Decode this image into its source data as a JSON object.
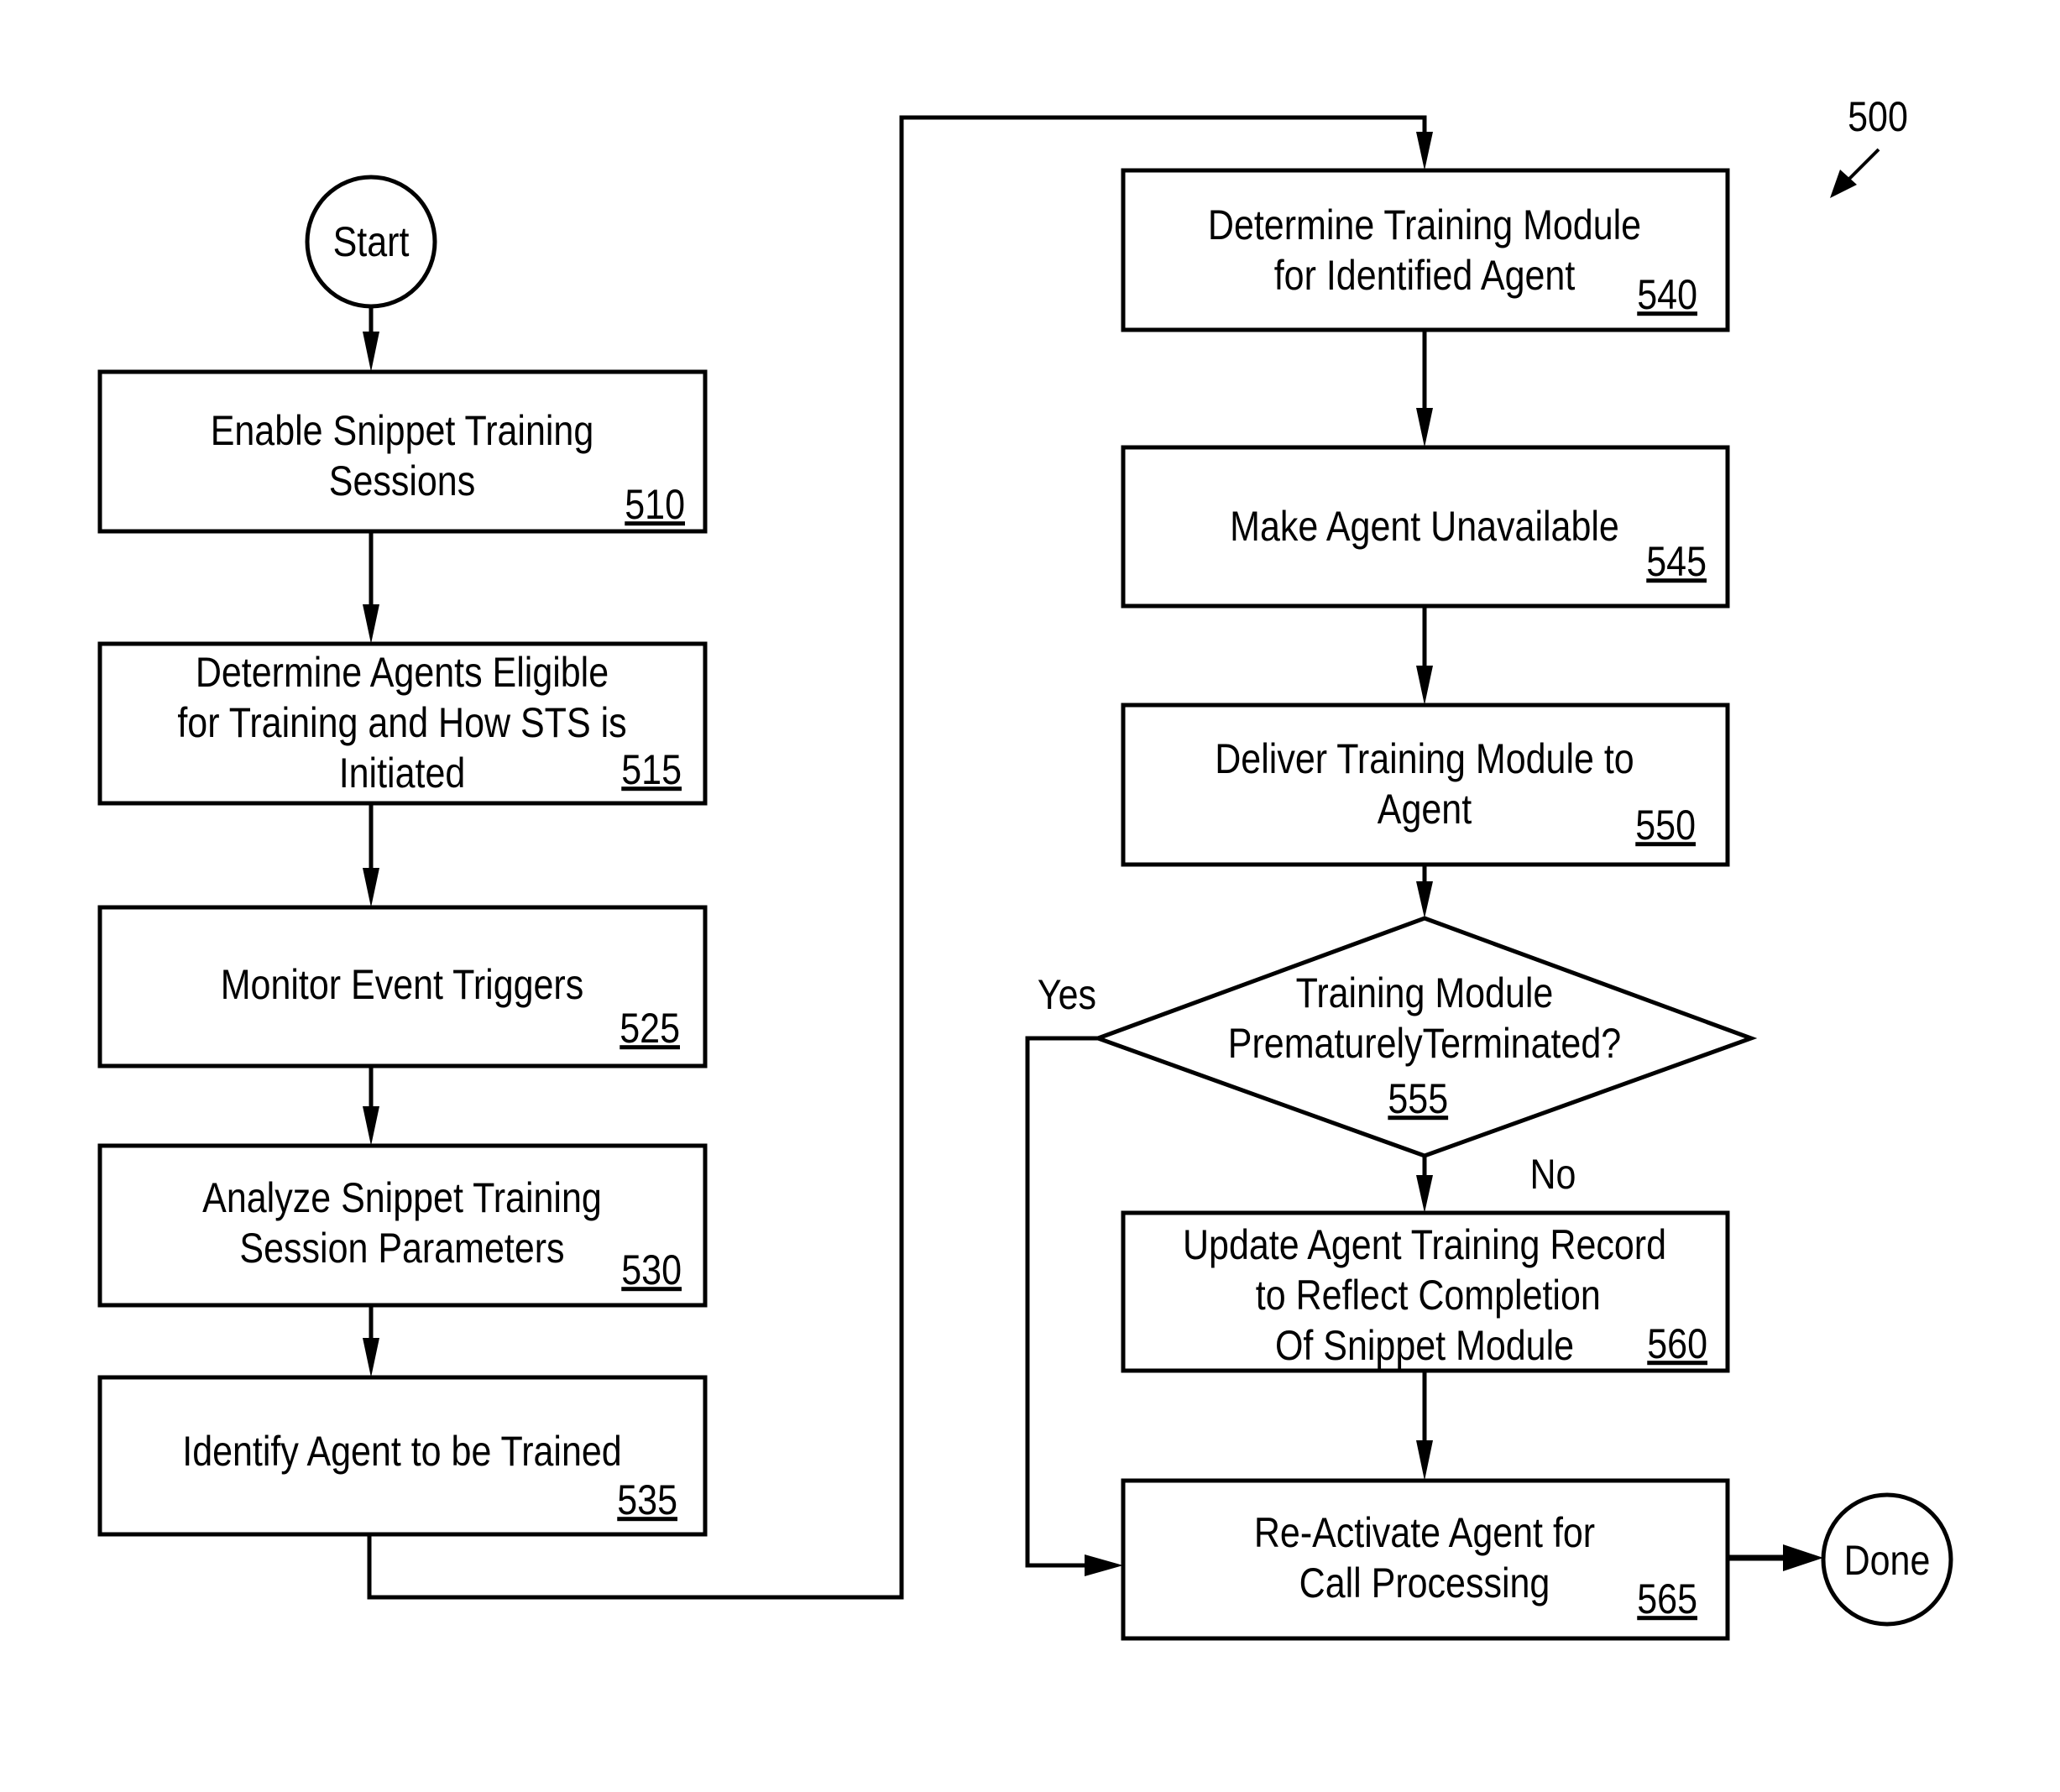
{
  "figure": {
    "reference_number": "500",
    "start_label": "Start",
    "end_label": "Done",
    "steps": [
      {
        "id": "510",
        "lines": [
          "Enable Snippet Training",
          "Sessions"
        ]
      },
      {
        "id": "515",
        "lines": [
          "Determine Agents Eligible",
          "for Training and How STS is",
          "Initiated"
        ]
      },
      {
        "id": "525",
        "lines": [
          "Monitor Event Triggers"
        ]
      },
      {
        "id": "530",
        "lines": [
          "Analyze Snippet Training",
          "Session Parameters"
        ]
      },
      {
        "id": "535",
        "lines": [
          "Identify Agent to be Trained"
        ]
      },
      {
        "id": "540",
        "lines": [
          "Determine Training Module",
          "for Identified Agent"
        ]
      },
      {
        "id": "545",
        "lines": [
          "Make Agent Unavailable"
        ]
      },
      {
        "id": "550",
        "lines": [
          "Deliver Training Module to",
          "Agent"
        ]
      },
      {
        "id": "560",
        "lines": [
          "Update Agent Training Record",
          "to Reflect Completion",
          "Of Snippet Module"
        ]
      },
      {
        "id": "565",
        "lines": [
          "Re-Activate Agent for",
          "Call Processing"
        ]
      }
    ],
    "decision": {
      "id": "555",
      "lines": [
        "Training Module",
        "PrematurelyTerminated?"
      ],
      "yes_label": "Yes",
      "no_label": "No"
    }
  }
}
